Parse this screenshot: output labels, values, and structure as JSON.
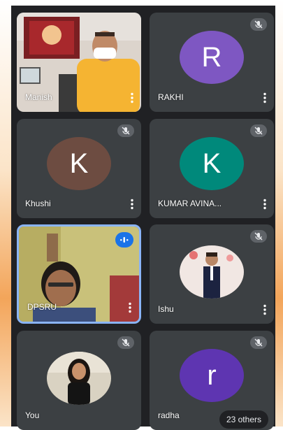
{
  "participants": [
    {
      "name": "Manish",
      "type": "video",
      "muted": false
    },
    {
      "name": "RAKHI",
      "type": "avatar",
      "initial": "R",
      "color": "#7e57c2",
      "muted": true
    },
    {
      "name": "Khushi",
      "type": "avatar",
      "initial": "K",
      "color": "#6d4c41",
      "muted": true
    },
    {
      "name": "KUMAR AVINA...",
      "type": "avatar",
      "initial": "K",
      "color": "#00897b",
      "muted": true
    },
    {
      "name": "DPSRU",
      "type": "video",
      "speaking": true
    },
    {
      "name": "Ishu",
      "type": "photo",
      "muted": true
    },
    {
      "name": "You",
      "type": "photo",
      "muted": true
    },
    {
      "name": "radha",
      "type": "avatar",
      "initial": "r",
      "color": "#5e35b1",
      "muted": true
    }
  ],
  "others_label": "23 others",
  "colors": {
    "grid_background": "#202124",
    "tile_background": "#3c4043",
    "active_border": "#8ab4f8",
    "speaking_indicator": "#1a73e8"
  },
  "icons": {
    "muted": "mic-off-icon",
    "speaking": "audio-level-icon",
    "menu": "more-vert-icon"
  }
}
